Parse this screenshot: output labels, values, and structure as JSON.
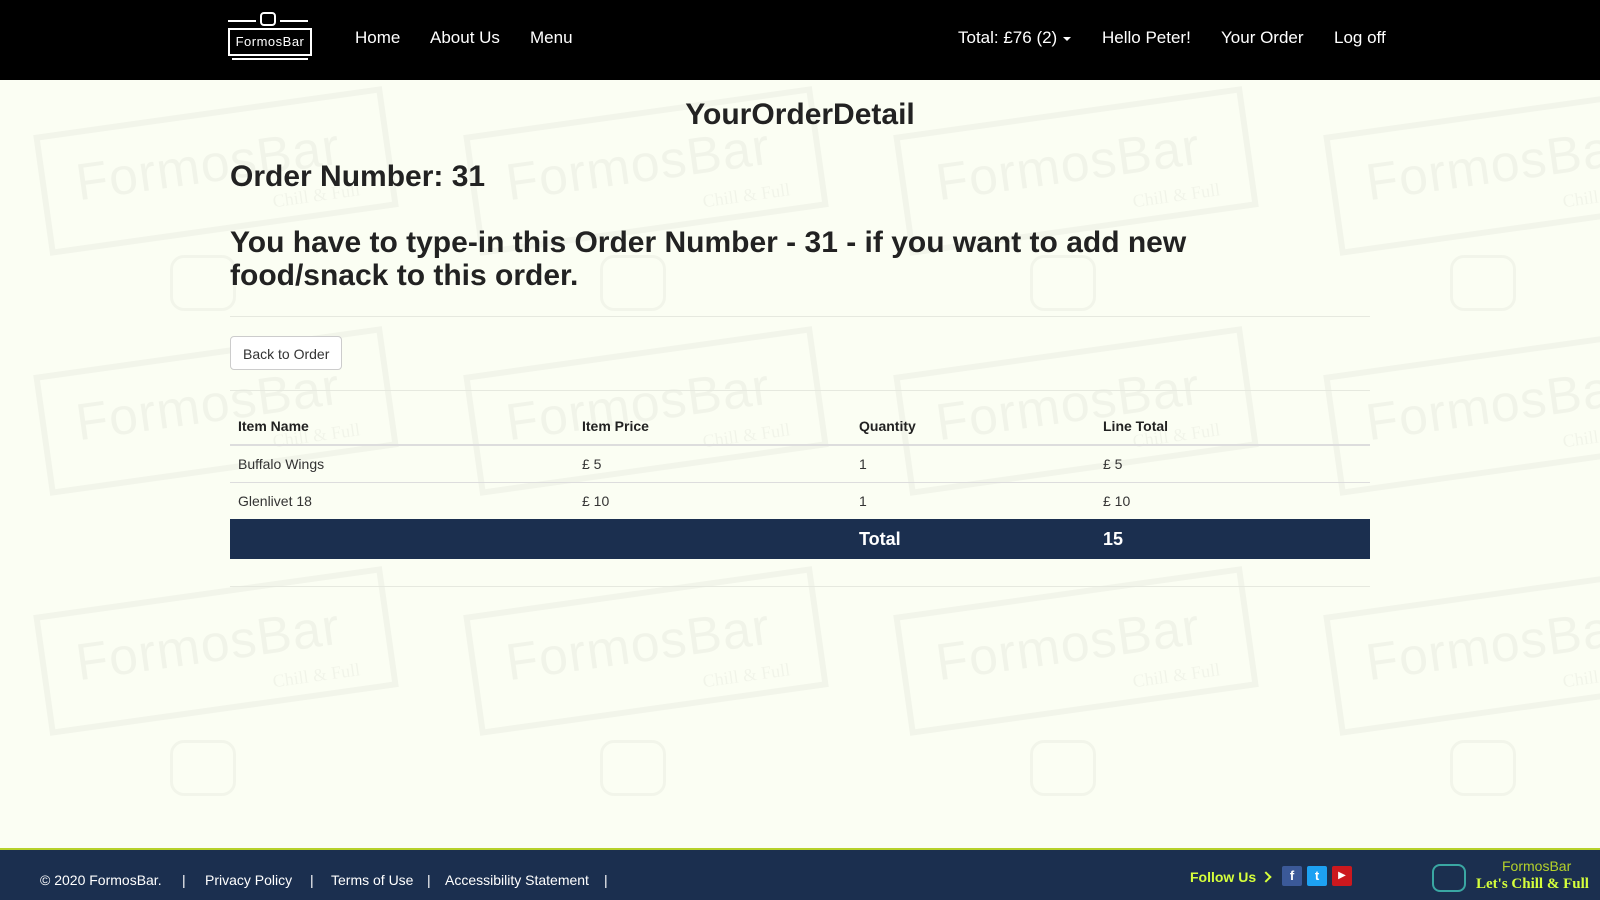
{
  "nav": {
    "brand": "FormosBar",
    "home": "Home",
    "about": "About Us",
    "menu": "Menu",
    "cart_total": "Total: £76 (2)",
    "greeting": "Hello Peter!",
    "your_order": "Your Order",
    "logoff": "Log off"
  },
  "page": {
    "title": "YourOrderDetail",
    "order_number": "Order Number: 31",
    "notice": "You have to type-in this Order Number - 31 - if you want to add new food/snack to this order.",
    "back_button": "Back to Order"
  },
  "table": {
    "headers": [
      "Item Name",
      "Item Price",
      "Quantity",
      "Line Total"
    ],
    "rows": [
      [
        "Buffalo Wings",
        "£ 5",
        "1",
        "£ 5"
      ],
      [
        "Glenlivet 18",
        "£ 10",
        "1",
        "£ 10"
      ]
    ],
    "total_label": "Total",
    "total_value": "15"
  },
  "footer": {
    "copyright": "© 2020 FormosBar.",
    "sep": "|",
    "privacy": "Privacy Policy",
    "terms": "Terms of Use",
    "accessibility": "Accessibility Statement",
    "follow": "Follow Us",
    "logo_brand": "FormosBar",
    "logo_slogan": "Let's Chill & Full"
  },
  "watermark": {
    "word": "FormosBar",
    "sub": "Chill & Full"
  },
  "colors": {
    "navbar": "#000000",
    "page_bg": "#fbfef3",
    "total_row": "#1b2f4f",
    "footer": "#1b2f4f",
    "accent_green": "#d6ff3b",
    "facebook": "#3b5998",
    "twitter": "#1da1f2",
    "youtube": "#cc181e"
  },
  "icons": [
    "barrel-logo-icon",
    "caret-down-icon",
    "chevron-right-icon",
    "facebook-icon",
    "twitter-icon",
    "youtube-icon"
  ]
}
